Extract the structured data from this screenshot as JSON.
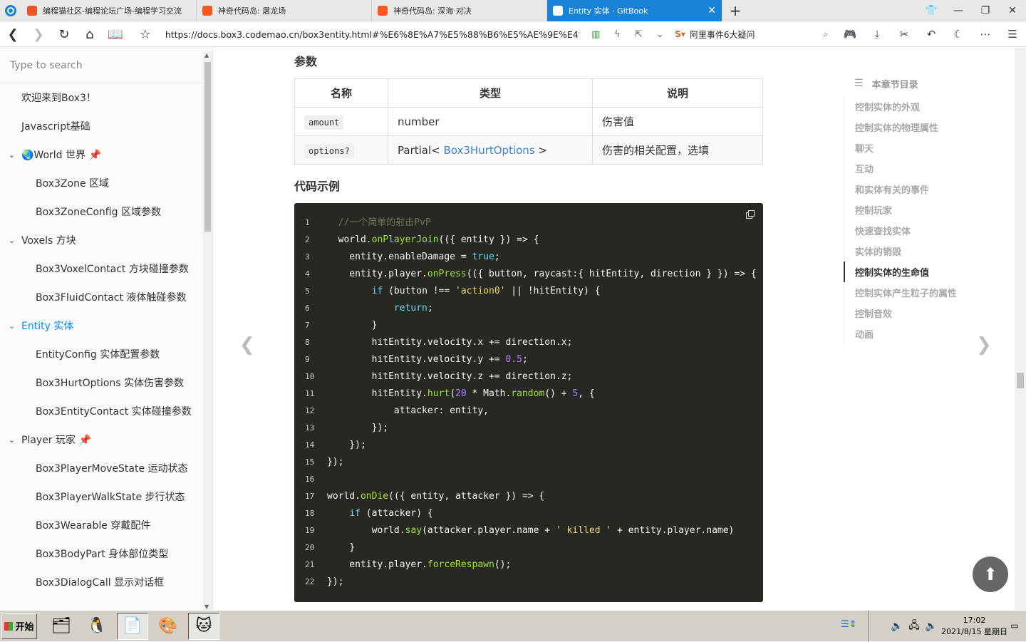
{
  "browser": {
    "tabs": [
      {
        "label": "编程猫社区-编程论坛广场-编程学习交流",
        "color": "#e8542c"
      },
      {
        "label": "神奇代码岛: 屠龙场",
        "color": "#f05a1e"
      },
      {
        "label": "神奇代码岛: 深海·对决",
        "color": "#f05a1e"
      },
      {
        "label": "Entity 实体 · GitBook",
        "color": "#ffffff"
      }
    ],
    "url": "https://docs.box3.codemao.cn/box3entity.html#%E6%8E%A7%E5%88%B6%E5%AE%9E%E4%BD%9",
    "search_text": "阿里事件6大疑问"
  },
  "sidebar": {
    "search_placeholder": "Type to search",
    "items": [
      {
        "label": "欢迎来到Box3！"
      },
      {
        "label": "Javascript基础"
      },
      {
        "label": "🌏World 世界 📌"
      },
      {
        "label": "Box3Zone 区域"
      },
      {
        "label": "Box3ZoneConfig 区域参数"
      },
      {
        "label": "Voxels 方块"
      },
      {
        "label": "Box3VoxelContact 方块碰撞参数"
      },
      {
        "label": "Box3FluidContact 液体触碰参数"
      },
      {
        "label": "Entity 实体"
      },
      {
        "label": "EntityConfig 实体配置参数"
      },
      {
        "label": "Box3HurtOptions 实体伤害参数"
      },
      {
        "label": "Box3EntityContact 实体碰撞参数"
      },
      {
        "label": "Player 玩家 📌"
      },
      {
        "label": "Box3PlayerMoveState 运动状态"
      },
      {
        "label": "Box3PlayerWalkState 步行状态"
      },
      {
        "label": "Box3Wearable 穿戴配件"
      },
      {
        "label": "Box3BodyPart 身体部位类型"
      },
      {
        "label": "Box3DialogCall 显示对话框"
      }
    ]
  },
  "content": {
    "params_heading": "参数",
    "table": {
      "headers": [
        "名称",
        "类型",
        "说明"
      ],
      "rows": [
        {
          "name": "amount",
          "type": "number",
          "desc": "伤害值"
        },
        {
          "name": "options?",
          "type_prefix": "Partial< ",
          "type_link": "Box3HurtOptions",
          "type_suffix": " >",
          "desc": "伤害的相关配置，选填"
        }
      ]
    },
    "code_heading": "代码示例",
    "code_line_numbers": [
      "1",
      "2",
      "3",
      "4",
      "5",
      "6",
      "7",
      "8",
      "9",
      "10",
      "11",
      "12",
      "13",
      "14",
      "15",
      "16",
      "17",
      "18",
      "19",
      "20",
      "21",
      "22"
    ]
  },
  "toc": {
    "heading": "本章节目录",
    "items": [
      "控制实体的外观",
      "控制实体的物理属性",
      "聊天",
      "互动",
      "和实体有关的事件",
      "控制玩家",
      "快速查找实体",
      "实体的销毁",
      "控制实体的生命值",
      "控制实体产生粒子的属性",
      "控制音效",
      "动画"
    ],
    "active": "控制实体的生命值"
  },
  "taskbar": {
    "start_label": "开始",
    "time": "17:02",
    "date": "2021/8/15 星期日"
  }
}
